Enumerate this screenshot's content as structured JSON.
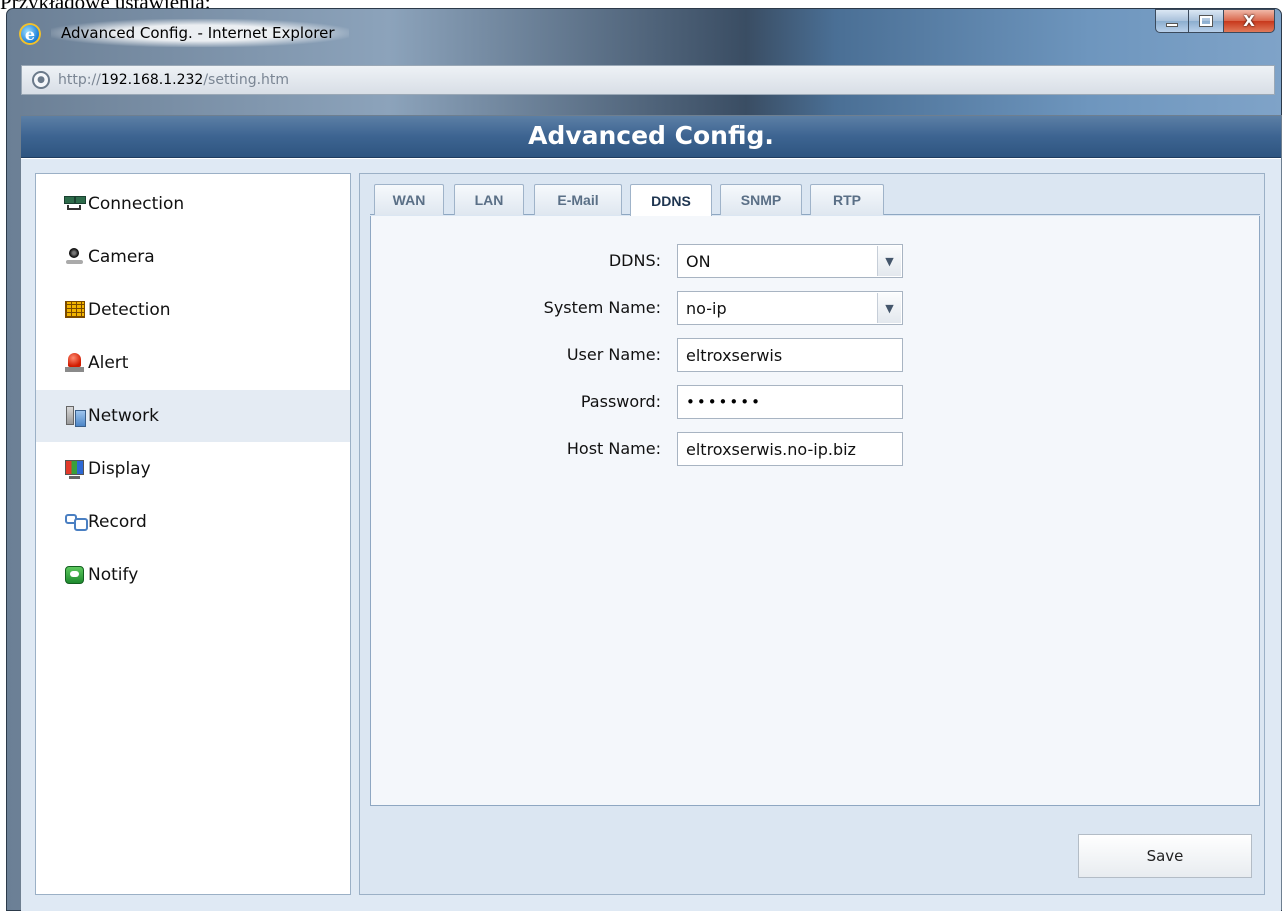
{
  "caption": "Przykładowe ustawienia:",
  "window": {
    "title": "Advanced Config. - Internet Explorer",
    "address": {
      "prefix": "http://",
      "host": "192.168.1.232",
      "path": "/setting.htm"
    }
  },
  "page": {
    "header": "Advanced Config."
  },
  "sidebar": {
    "items": [
      {
        "label": "Connection",
        "icon": "connection-icon"
      },
      {
        "label": "Camera",
        "icon": "camera-icon"
      },
      {
        "label": "Detection",
        "icon": "detection-grid-icon"
      },
      {
        "label": "Alert",
        "icon": "alarm-siren-icon"
      },
      {
        "label": "Network",
        "icon": "network-icon",
        "active": true
      },
      {
        "label": "Display",
        "icon": "display-icon"
      },
      {
        "label": "Record",
        "icon": "record-icon"
      },
      {
        "label": "Notify",
        "icon": "notify-icon"
      }
    ]
  },
  "tabs": [
    {
      "label": "WAN"
    },
    {
      "label": "LAN"
    },
    {
      "label": "E-Mail"
    },
    {
      "label": "DDNS",
      "active": true
    },
    {
      "label": "SNMP"
    },
    {
      "label": "RTP"
    }
  ],
  "form": {
    "ddns_label": "DDNS:",
    "ddns_value": "ON",
    "system_name_label": "System Name:",
    "system_name_value": "no-ip",
    "user_name_label": "User Name:",
    "user_name_value": "eltroxserwis",
    "password_label": "Password:",
    "password_value": "•••••••",
    "host_name_label": "Host Name:",
    "host_name_value": "eltroxserwis.no-ip.biz"
  },
  "actions": {
    "save_label": "Save"
  },
  "colors": {
    "header_bg": "#3d6491",
    "content_bg": "#dfe9f4",
    "active_nav": "#e4ebf3"
  }
}
